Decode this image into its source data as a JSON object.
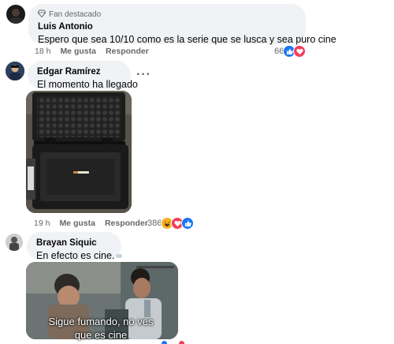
{
  "comments": [
    {
      "badge": "Fan destacado",
      "author": "Luis Antonio",
      "text": "Espero que sea 10/10 como es la serie que se lusca y sea puro cine",
      "time": "18 h",
      "like_label": "Me gusta",
      "reply_label": "Responder",
      "reaction_count": "66",
      "reactions": [
        "like-icon",
        "love-icon"
      ]
    },
    {
      "author": "Edgar Ramírez",
      "text": "El momento ha llegado",
      "more": "···",
      "time": "19 h",
      "like_label": "Me gusta",
      "reply_label": "Responder",
      "reaction_count": "386",
      "reactions": [
        "haha-icon",
        "love-icon",
        "like-icon"
      ]
    },
    {
      "author": "Brayan Siquic",
      "text": "En efecto es cine.",
      "gif_caption": "Sigue fumando, no ves que es cine"
    }
  ],
  "colors": {
    "like": "#1877f2",
    "love": "#f33e58",
    "haha": "#f7b125",
    "meta": "#65676b",
    "bubble": "#f0f2f5"
  }
}
